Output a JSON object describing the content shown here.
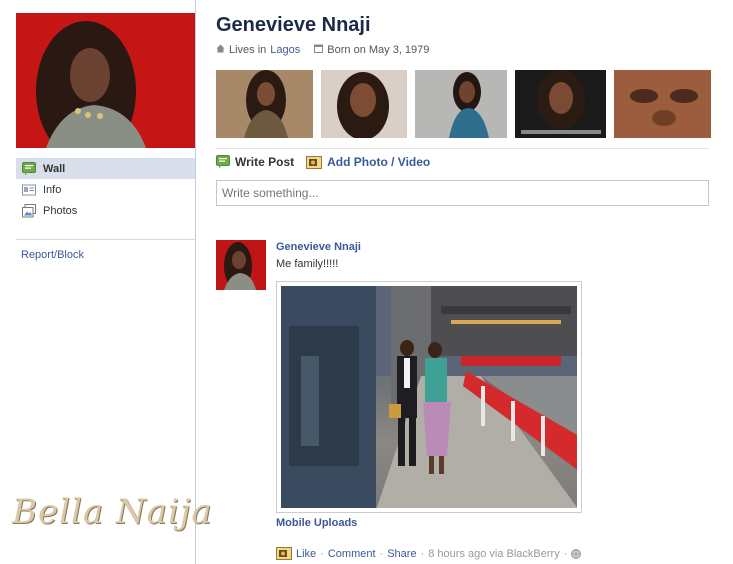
{
  "profile": {
    "name": "Genevieve Nnaji",
    "lives_prefix": "Lives in",
    "lives_city": "Lagos",
    "born": "Born on May 3, 1979"
  },
  "sidebar": {
    "items": [
      {
        "label": "Wall",
        "icon": "wall-icon",
        "active": true
      },
      {
        "label": "Info",
        "icon": "info-icon",
        "active": false
      },
      {
        "label": "Photos",
        "icon": "photos-icon",
        "active": false
      }
    ],
    "report_label": "Report/Block"
  },
  "composer": {
    "write_post_label": "Write Post",
    "add_photo_label": "Add Photo / Video",
    "placeholder": "Write something..."
  },
  "post": {
    "author": "Genevieve Nnaji",
    "text": "Me family!!!!!",
    "album_link": "Mobile Uploads",
    "like_label": "Like",
    "comment_label": "Comment",
    "share_label": "Share",
    "timestamp": "8 hours ago via BlackBerry"
  },
  "watermark": "BellaNaija",
  "colors": {
    "link": "#3b5998",
    "name": "#1c2a47",
    "nav_active_bg": "#d8dfea"
  }
}
